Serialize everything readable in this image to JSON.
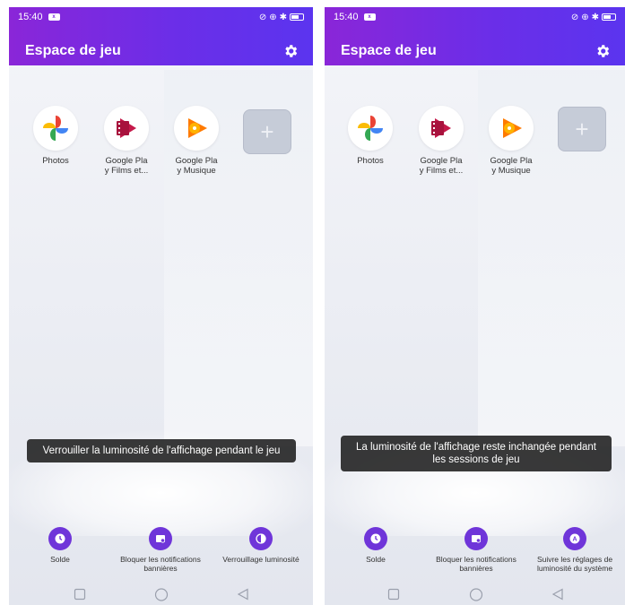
{
  "status": {
    "time": "15:40",
    "sim_badge": "x"
  },
  "title": "Espace de jeu",
  "apps": [
    {
      "name": "photos-app",
      "label": "Photos",
      "icon": "google-photos-icon"
    },
    {
      "name": "play-films-app",
      "label": "Google Pla\ny Films et...",
      "icon": "google-play-films-icon"
    },
    {
      "name": "play-music-app",
      "label": "Google Pla\ny Musique",
      "icon": "google-play-music-icon"
    }
  ],
  "add_label": "+",
  "left": {
    "toast": "Verrouiller la luminosité de l'affichage pendant le jeu",
    "controls": [
      {
        "label": "Solde"
      },
      {
        "label": "Bloquer les notifications\nbannières"
      },
      {
        "label": "Verrouillage luminosité"
      }
    ]
  },
  "right": {
    "toast": "La luminosité de l'affichage reste inchangée pendant les sessions de jeu",
    "controls": [
      {
        "label": "Solde"
      },
      {
        "label": "Bloquer les notifications\nbannières"
      },
      {
        "label": "Suivre les réglages de\nluminosité du système"
      }
    ]
  },
  "colors": {
    "accent": "#6f35d9",
    "appbar_start": "#8a26d8",
    "appbar_end": "#5b34ef"
  }
}
